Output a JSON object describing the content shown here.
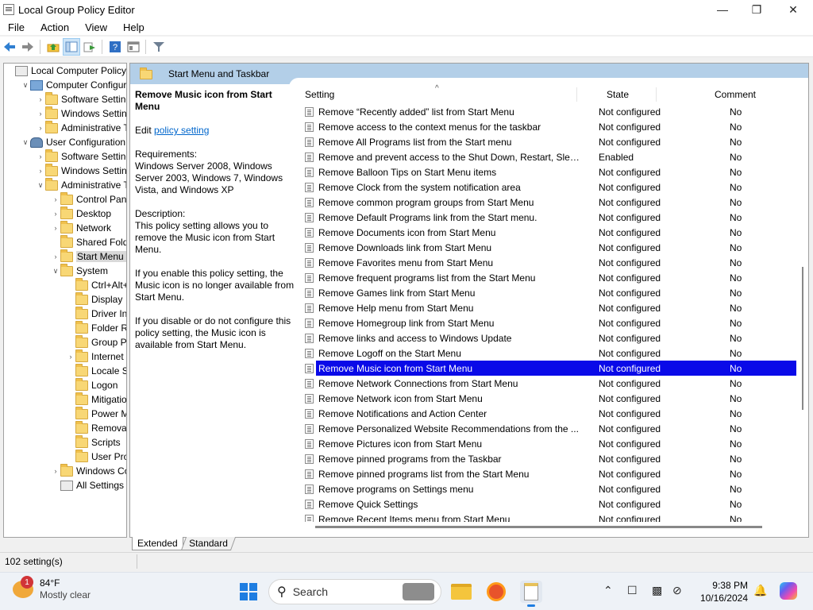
{
  "window": {
    "title": "Local Group Policy Editor",
    "min": "—",
    "max": "❐",
    "close": "✕"
  },
  "menu": [
    "File",
    "Action",
    "View",
    "Help"
  ],
  "toolbar": [
    "back-icon",
    "forward-icon",
    "up-folder-icon",
    "show-hide-tree-icon",
    "export-list-icon",
    "help-icon",
    "properties-icon",
    "filter-icon"
  ],
  "tree": [
    {
      "label": "Local Computer Policy",
      "depth": 0,
      "expander": "",
      "icon": "policy"
    },
    {
      "label": "Computer Configura",
      "depth": 1,
      "expander": "v",
      "icon": "computer"
    },
    {
      "label": "Software Settings",
      "depth": 2,
      "expander": ">",
      "icon": "folder"
    },
    {
      "label": "Windows Setting",
      "depth": 2,
      "expander": ">",
      "icon": "folder"
    },
    {
      "label": "Administrative Te",
      "depth": 2,
      "expander": ">",
      "icon": "folder"
    },
    {
      "label": "User Configuration",
      "depth": 1,
      "expander": "v",
      "icon": "user"
    },
    {
      "label": "Software Settings",
      "depth": 2,
      "expander": ">",
      "icon": "folder"
    },
    {
      "label": "Windows Setting",
      "depth": 2,
      "expander": ">",
      "icon": "folder"
    },
    {
      "label": "Administrative Te",
      "depth": 2,
      "expander": "v",
      "icon": "folder"
    },
    {
      "label": "Control Panel",
      "depth": 3,
      "expander": ">",
      "icon": "folder"
    },
    {
      "label": "Desktop",
      "depth": 3,
      "expander": ">",
      "icon": "folder"
    },
    {
      "label": "Network",
      "depth": 3,
      "expander": ">",
      "icon": "folder"
    },
    {
      "label": "Shared Folder",
      "depth": 3,
      "expander": "",
      "icon": "folder"
    },
    {
      "label": "Start Menu ar",
      "depth": 3,
      "expander": ">",
      "icon": "folder",
      "selected": true
    },
    {
      "label": "System",
      "depth": 3,
      "expander": "v",
      "icon": "folder"
    },
    {
      "label": "Ctrl+Alt+I",
      "depth": 4,
      "expander": "",
      "icon": "folder"
    },
    {
      "label": "Display",
      "depth": 4,
      "expander": "",
      "icon": "folder"
    },
    {
      "label": "Driver Inst",
      "depth": 4,
      "expander": "",
      "icon": "folder"
    },
    {
      "label": "Folder Rec",
      "depth": 4,
      "expander": "",
      "icon": "folder"
    },
    {
      "label": "Group Pol",
      "depth": 4,
      "expander": "",
      "icon": "folder"
    },
    {
      "label": "Internet C",
      "depth": 4,
      "expander": ">",
      "icon": "folder"
    },
    {
      "label": "Locale Ser",
      "depth": 4,
      "expander": "",
      "icon": "folder"
    },
    {
      "label": "Logon",
      "depth": 4,
      "expander": "",
      "icon": "folder"
    },
    {
      "label": "Mitigation",
      "depth": 4,
      "expander": "",
      "icon": "folder"
    },
    {
      "label": "Power Ma",
      "depth": 4,
      "expander": "",
      "icon": "folder"
    },
    {
      "label": "Removabl",
      "depth": 4,
      "expander": "",
      "icon": "folder"
    },
    {
      "label": "Scripts",
      "depth": 4,
      "expander": "",
      "icon": "folder"
    },
    {
      "label": "User Profi",
      "depth": 4,
      "expander": "",
      "icon": "folder"
    },
    {
      "label": "Windows Cor",
      "depth": 3,
      "expander": ">",
      "icon": "folder"
    },
    {
      "label": "All Settings",
      "depth": 3,
      "expander": "",
      "icon": "settings"
    }
  ],
  "pane": {
    "header": "Start Menu and Taskbar",
    "desc_title": "Remove Music icon from Start Menu",
    "edit_prefix": "Edit ",
    "edit_link": "policy setting",
    "requirements": "Requirements:\nWindows Server 2008, Windows Server 2003, Windows 7, Windows Vista, and Windows XP",
    "description_label": "Description:",
    "description": "This policy setting allows you to remove the Music icon from Start Menu.",
    "enable_text": "If you enable this policy setting, the Music icon is no longer available from Start Menu.",
    "disable_text": "If you disable or do not configure this policy setting, the Music icon is available from Start Menu."
  },
  "columns": {
    "setting": "Setting",
    "state": "State",
    "comment": "Comment",
    "sort_glyph": "^"
  },
  "rows": [
    {
      "name": "Remove “Recently added” list from Start Menu",
      "state": "Not configured",
      "comment": "No"
    },
    {
      "name": "Remove access to the context menus for the taskbar",
      "state": "Not configured",
      "comment": "No"
    },
    {
      "name": "Remove All Programs list from the Start menu",
      "state": "Not configured",
      "comment": "No"
    },
    {
      "name": "Remove and prevent access to the Shut Down, Restart, Sleep...",
      "state": "Enabled",
      "comment": "No"
    },
    {
      "name": "Remove Balloon Tips on Start Menu items",
      "state": "Not configured",
      "comment": "No"
    },
    {
      "name": "Remove Clock from the system notification area",
      "state": "Not configured",
      "comment": "No"
    },
    {
      "name": "Remove common program groups from Start Menu",
      "state": "Not configured",
      "comment": "No"
    },
    {
      "name": "Remove Default Programs link from the Start menu.",
      "state": "Not configured",
      "comment": "No"
    },
    {
      "name": "Remove Documents icon from Start Menu",
      "state": "Not configured",
      "comment": "No"
    },
    {
      "name": "Remove Downloads link from Start Menu",
      "state": "Not configured",
      "comment": "No"
    },
    {
      "name": "Remove Favorites menu from Start Menu",
      "state": "Not configured",
      "comment": "No"
    },
    {
      "name": "Remove frequent programs list from the Start Menu",
      "state": "Not configured",
      "comment": "No"
    },
    {
      "name": "Remove Games link from Start Menu",
      "state": "Not configured",
      "comment": "No"
    },
    {
      "name": "Remove Help menu from Start Menu",
      "state": "Not configured",
      "comment": "No"
    },
    {
      "name": "Remove Homegroup link from Start Menu",
      "state": "Not configured",
      "comment": "No"
    },
    {
      "name": "Remove links and access to Windows Update",
      "state": "Not configured",
      "comment": "No"
    },
    {
      "name": "Remove Logoff on the Start Menu",
      "state": "Not configured",
      "comment": "No"
    },
    {
      "name": "Remove Music icon from Start Menu",
      "state": "Not configured",
      "comment": "No",
      "selected": true
    },
    {
      "name": "Remove Network Connections from Start Menu",
      "state": "Not configured",
      "comment": "No"
    },
    {
      "name": "Remove Network icon from Start Menu",
      "state": "Not configured",
      "comment": "No"
    },
    {
      "name": "Remove Notifications and Action Center",
      "state": "Not configured",
      "comment": "No"
    },
    {
      "name": "Remove Personalized Website Recommendations from the ...",
      "state": "Not configured",
      "comment": "No"
    },
    {
      "name": "Remove Pictures icon from Start Menu",
      "state": "Not configured",
      "comment": "No"
    },
    {
      "name": "Remove pinned programs from the Taskbar",
      "state": "Not configured",
      "comment": "No"
    },
    {
      "name": "Remove pinned programs list from the Start Menu",
      "state": "Not configured",
      "comment": "No"
    },
    {
      "name": "Remove programs on Settings menu",
      "state": "Not configured",
      "comment": "No"
    },
    {
      "name": "Remove Quick Settings",
      "state": "Not configured",
      "comment": "No"
    },
    {
      "name": "Remove Recent Items menu from Start Menu",
      "state": "Not configured",
      "comment": "No"
    }
  ],
  "tabs": {
    "extended": "Extended",
    "standard": "Standard"
  },
  "status": "102 setting(s)",
  "taskbar": {
    "weather_badge": "1",
    "temp": "84°F",
    "condition": "Mostly clear",
    "search": "Search",
    "time": "9:38 PM",
    "date": "10/16/2024",
    "start_color": "#1e7de1"
  }
}
